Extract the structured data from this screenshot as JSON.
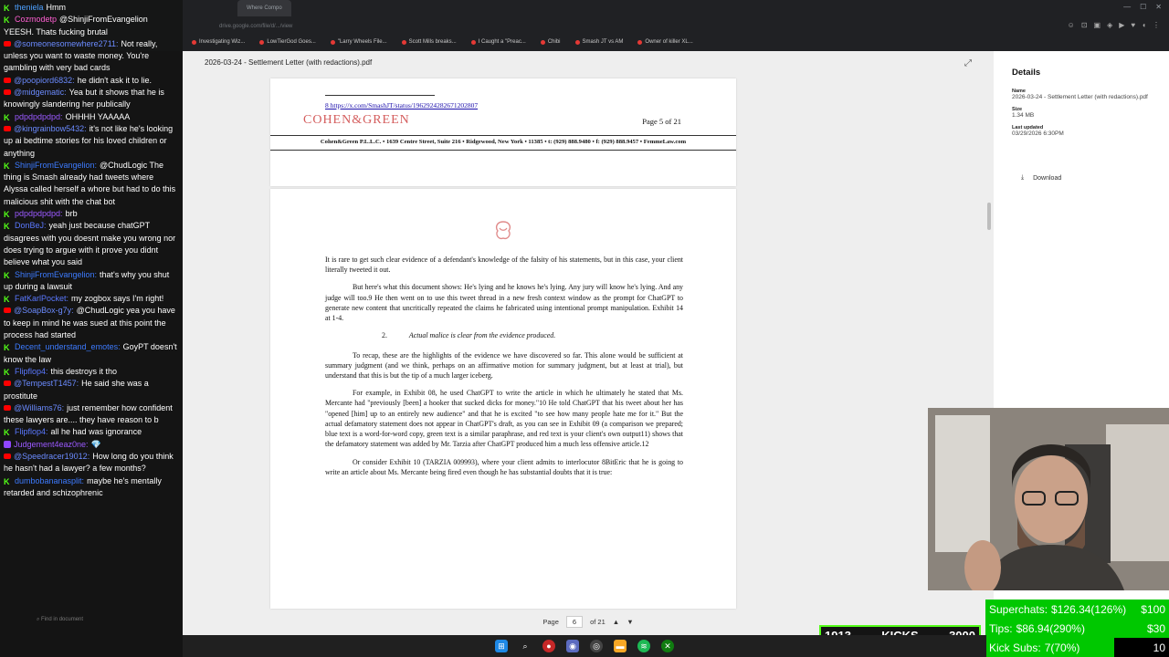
{
  "browser": {
    "tab_title": "Where Compo",
    "url": "drive.google.com/file/d/.../view",
    "bookmarks": [
      "Investigating Wiz...",
      "LowTierGod Goes...",
      "\"Larry Wheels File...",
      "Scott Mills breaks...",
      "I Caught a \"Preac...",
      "Chibi",
      "Smash JT vs AM",
      "Owner of killer XL..."
    ]
  },
  "viewer": {
    "file_title": "2026-03-24 - Settlement Letter (with redactions).pdf",
    "page_a": {
      "footnote": "8 https://x.com/SmashJT/status/1962924282671202807",
      "firm_logo": "COHEN&GREEN",
      "page_label": "Page 5 of 21",
      "letterhead": "Cohen&Green P.L.L.C.  •  1639 Centre Street, Suite 216 • Ridgewood, New York • 11385  •  t: (929) 888.9480  •  f: (929) 888.9457  •  FemmeLaw.com"
    },
    "page_b": {
      "p1": "It is rare to get such clear evidence of a defendant's knowledge of the falsity of his statements, but in this case, your client literally tweeted it out.",
      "p2": "But here's what this document shows:  He's lying and he knows he's lying. Any jury will know he's lying. And any judge will too.9 He then went on to use this tweet thread in a new fresh context window as the prompt for ChatGPT to generate new content that uncritically repeated the claims he fabricated using intentional prompt manipulation. Exhibit 14 at 1-4.",
      "heading_num": "2.",
      "heading_text": "Actual malice is clear from the evidence produced.",
      "p3": "To recap, these are the highlights of the evidence we have discovered so far. This alone would be sufficient at summary judgment (and we think, perhaps on an affirmative motion for summary judgment, but at least at trial), but understand that this is but the tip of a much larger iceberg.",
      "p4": "For example, in Exhibit 08, he used ChatGPT to write the article in which he ultimately he stated that Ms. Mercante had \"previously [been] a hooker that sucked dicks for money.\"10 He told ChatGPT that his tweet about her has \"opened [him] up to an entirely new audience\" and that he is excited \"to see how many people hate me for it.\" But the actual defamatory statement does not appear in ChatGPT's draft, as you can see in Exhibit 09 (a comparison we prepared; blue text is a word-for-word copy, green text is a similar paraphrase, and red text is your client's own output11) shows that the defamatory statement was added by Mr. Tarzia after ChatGPT produced him a much less offensive article.12",
      "p5": "Or consider Exhibit 10 (TARZIA 009993), where your client admits to interlocutor 8BitEric that he is going to write an article about Ms. Mercante being fired even though he has substantial doubts that it is true:"
    },
    "pager": {
      "label": "Page",
      "current": "6",
      "of": "of 21"
    }
  },
  "details": {
    "title": "Details",
    "name_label": "Name",
    "name_value": "2026-03-24 - Settlement Letter (with redactions).pdf",
    "size_label": "Size",
    "size_value": "1.34 MB",
    "updated_label": "Last updated",
    "updated_value": "03/29/2026 6:30PM",
    "download_label": "Download"
  },
  "chat": [
    {
      "platform": "k",
      "user": "theniela",
      "color": "#4ea1ff",
      "text": "Hmm"
    },
    {
      "platform": "k",
      "user": "Cozmodetp",
      "color": "#ff5fd2",
      "text": "@ShinjiFromEvangelion YEESH. Thats fucking brutal"
    },
    {
      "platform": "y",
      "user": "@someonesomewhere2711:",
      "color": "#6b8bff",
      "text": "Not really, unless you want to waste money. You're gambling with very bad cards"
    },
    {
      "platform": "y",
      "user": "@poopiord6832:",
      "color": "#6b8bff",
      "text": "he didn't ask it to lie."
    },
    {
      "platform": "y",
      "user": "@midgematic:",
      "color": "#6b8bff",
      "text": "Yea but it shows that he is knowingly slandering her publically"
    },
    {
      "platform": "k",
      "user": "pdpdpdpdpd:",
      "color": "#9b59ff",
      "text": "OHHHH YAAAAA"
    },
    {
      "platform": "y",
      "user": "@kingrainbow5432:",
      "color": "#6b8bff",
      "text": "it's not like he's looking up ai bedtime stories for his loved children or anything"
    },
    {
      "platform": "k",
      "user": "ShinjiFromEvangelion:",
      "color": "#3d7bff",
      "text": "@ChudLogic The thing is Smash already had tweets where Alyssa called herself a whore but had to do this malicious shit with the chat bot"
    },
    {
      "platform": "k",
      "user": "pdpdpdpdpd:",
      "color": "#9b59ff",
      "text": "brb"
    },
    {
      "platform": "k",
      "user": "DonBeJ:",
      "color": "#5a78ff",
      "text": "yeah just because chatGPT disagrees with you doesnt make you wrong nor does trying to argue with it prove you didnt believe what you said"
    },
    {
      "platform": "k",
      "user": "ShinjiFromEvangelion:",
      "color": "#3d7bff",
      "text": "that's why you shut up during a lawsuit"
    },
    {
      "platform": "k",
      "user": "FatKarlPocket:",
      "color": "#5a78ff",
      "text": "my zogbox says I'm right!"
    },
    {
      "platform": "y",
      "user": "@SoapBox-g7y:",
      "color": "#6b8bff",
      "text": "@ChudLogic yea you have to keep in mind he was sued at this point the process had started"
    },
    {
      "platform": "k",
      "user": "Decent_understand_emotes:",
      "color": "#3d7bff",
      "text": "GoyPT doesn't know the law"
    },
    {
      "platform": "k",
      "user": "Flipflop4:",
      "color": "#5a78ff",
      "text": "this destroys it tho"
    },
    {
      "platform": "y",
      "user": "@TempestT1457:",
      "color": "#6b8bff",
      "text": "He said she was a prostitute"
    },
    {
      "platform": "y",
      "user": "@Williams76:",
      "color": "#6b8bff",
      "text": "just remember how confident these lawyers are.... they have reason to b"
    },
    {
      "platform": "k",
      "user": "Flipflop4:",
      "color": "#5a78ff",
      "text": "all he had was ignorance"
    },
    {
      "platform": "t",
      "user": "Judgement4eaz0ne:",
      "color": "#9b59ff",
      "text": "💎"
    },
    {
      "platform": "y",
      "user": "@Speedracer19012:",
      "color": "#6b8bff",
      "text": "How long do you think he hasn't had a lawyer? a few months?"
    },
    {
      "platform": "k",
      "user": "dumbobananasplit:",
      "color": "#3d7bff",
      "text": "maybe he's mentally retarded and schizophrenic"
    }
  ],
  "find_in_document": "Find in document",
  "kicks": {
    "count": "1913",
    "label": "KICKS",
    "goal": "3000"
  },
  "stats": [
    {
      "label": "Superchats:",
      "value": "$126.34(126%)",
      "goal": "$100",
      "fill": 1.0
    },
    {
      "label": "Tips:",
      "value": "$86.94(290%)",
      "goal": "$30",
      "fill": 1.0
    },
    {
      "label": "Kick Subs:",
      "value": "7(70%)",
      "goal": "10",
      "fill": 0.7
    }
  ],
  "colors": {
    "kick_green": "#53fc18",
    "stat_green": "#00c800",
    "accent_red": "#d45d5d"
  }
}
